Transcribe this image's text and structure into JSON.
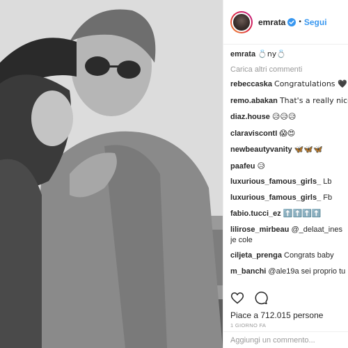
{
  "post": {
    "image_alt": "Black and white photo of a couple embracing on a rooftop",
    "header": {
      "username": "emrata",
      "verified": true,
      "follow_label": "Segui",
      "separator": "•"
    },
    "caption": {
      "username": "emrata",
      "text": "💍ny💍"
    },
    "load_more_label": "Carica altri commenti",
    "comments": [
      {
        "username": "rebeccaska",
        "text": "Congratulations 🖤💍"
      },
      {
        "username": "remo.abakan",
        "text": "That's a really nice 😍"
      },
      {
        "username": "diaz.house",
        "text": "😥😥😥"
      },
      {
        "username": "claraviscontI",
        "text": "😱😍"
      },
      {
        "username": "newbeautyvanity",
        "text": "🦋🦋🦋"
      },
      {
        "username": "paafeu",
        "text": "😥"
      },
      {
        "username": "luxurious_famous_girls_",
        "text": "Lb"
      },
      {
        "username": "luxurious_famous_girls_",
        "text": "Fb"
      },
      {
        "username": "fabio.tucci_ez",
        "text": "⬆️⬆️⬆️⬆️"
      },
      {
        "username": "lilirose_mirbeau",
        "text": "@_delaat_ines je cole"
      },
      {
        "username": "ciljeta_prenga",
        "text": "Congrats baby"
      },
      {
        "username": "m_banchi",
        "text": "@ale19a sei proprio tu"
      }
    ],
    "likes_label": "Piace a 712.015 persone",
    "timestamp": "1 giorno fa",
    "comment_placeholder": "Aggiungi un commento...",
    "colors": {
      "link_blue": "#3897f0",
      "text": "#262626",
      "muted": "#999999",
      "border": "#efefef"
    }
  }
}
